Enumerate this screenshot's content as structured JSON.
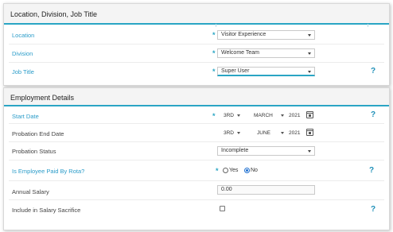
{
  "location_section": {
    "title": "Location, Division, Job Title",
    "location_label": "Location",
    "location_value": "Visitor Experience",
    "division_label": "Division",
    "division_value": "Welcome Team",
    "job_title_label": "Job Title",
    "job_title_value": "Super User",
    "required_marker": "*",
    "help": "?"
  },
  "employment_section": {
    "title": "Employment Details",
    "start_date_label": "Start Date",
    "start_date": {
      "day": "3RD",
      "month": "MARCH",
      "year": "2021"
    },
    "probation_end_label": "Probation End Date",
    "probation_end": {
      "day": "3RD",
      "month": "JUNE",
      "year": "2021"
    },
    "probation_status_label": "Probation Status",
    "probation_status_value": "Incomplete",
    "paid_by_rota_label": "Is Employee Paid By Rota?",
    "paid_by_rota_options": [
      "Yes",
      "No"
    ],
    "paid_by_rota_selected": "No",
    "annual_salary_label": "Annual Salary",
    "annual_salary_value": "0.00",
    "salary_sacrifice_label": "Include in Salary Sacrifice",
    "salary_sacrifice_checked": false,
    "required_marker": "*",
    "help": "?"
  }
}
